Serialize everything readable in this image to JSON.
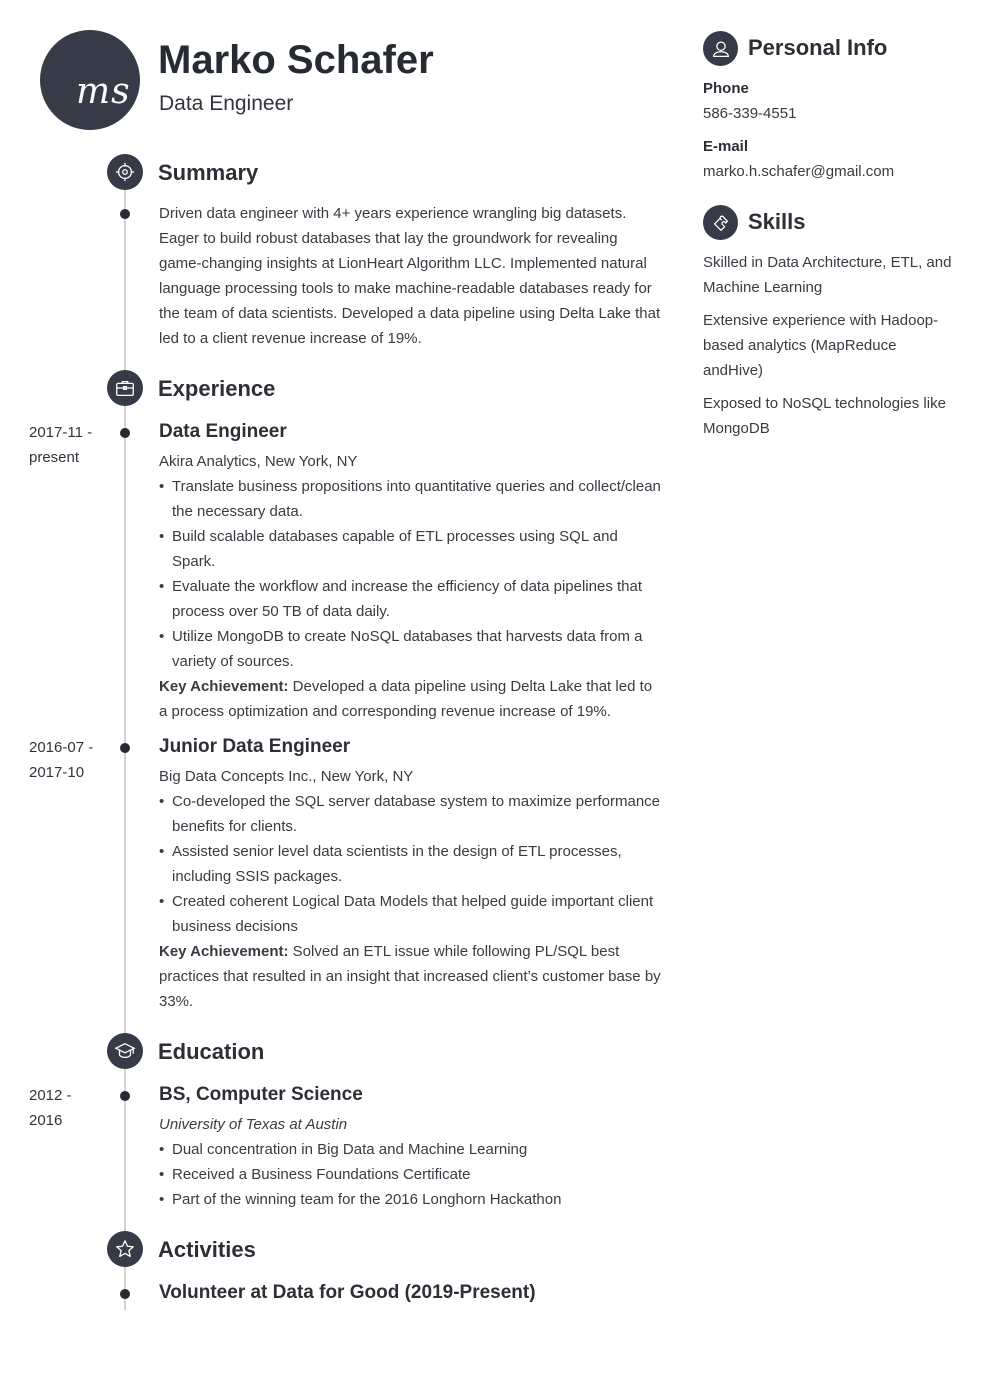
{
  "header": {
    "initials": "ms",
    "name": "Marko Schafer",
    "title": "Data Engineer"
  },
  "colors": {
    "accent": "#363b47",
    "text": "#2c2f36",
    "timeline": "#d3d3d3"
  },
  "summary": {
    "title": "Summary",
    "icon": "target-icon",
    "text": "Driven data engineer with 4+ years experience wrangling big datasets. Eager to build robust databases that lay the groundwork for revealing game-changing insights at LionHeart Algorithm LLC. Implemented natural language processing tools to make machine-readable databases ready for the team of data scientists. Developed a data pipeline using Delta Lake that led to a client revenue increase of 19%."
  },
  "experience": {
    "title": "Experience",
    "icon": "briefcase-icon",
    "jobs": [
      {
        "date_start": "2017-11 -",
        "date_end": "present",
        "title": "Data Engineer",
        "company": "Akira Analytics, New York, NY",
        "bullets": [
          "Translate business propositions into quantitative queries and collect/clean the necessary data.",
          "Build scalable databases capable of ETL processes using SQL and Spark.",
          "Evaluate the workflow and increase the efficiency of data pipelines that process over 50 TB of data daily.",
          "Utilize MongoDB to create NoSQL databases that harvests data from a variety of sources."
        ],
        "key_label": "Key Achievement:",
        "key_text": " Developed a data pipeline using Delta Lake that led to a process optimization and corresponding revenue increase of 19%."
      },
      {
        "date_start": "2016-07 -",
        "date_end": "2017-10",
        "title": "Junior Data Engineer",
        "company": "Big Data Concepts Inc., New York, NY",
        "bullets": [
          "Co-developed the SQL server database system to maximize performance benefits for clients.",
          "Assisted senior level data scientists in the design of ETL processes, including SSIS packages.",
          "Created coherent Logical Data Models that helped guide important client business decisions"
        ],
        "key_label": "Key Achievement:",
        "key_text": " Solved an ETL issue while following PL/SQL best practices that resulted in an insight that increased client’s customer base by 33%."
      }
    ]
  },
  "education": {
    "title": "Education",
    "icon": "graduation-cap-icon",
    "items": [
      {
        "date_start": "2012 -",
        "date_end": "2016",
        "degree": "BS, Computer Science",
        "school": "University of Texas at Austin",
        "bullets": [
          "Dual concentration in Big Data and Machine Learning",
          "Received a Business Foundations Certificate",
          "Part of the winning team for the 2016 Longhorn Hackathon"
        ]
      }
    ]
  },
  "activities": {
    "title": "Activities",
    "icon": "star-icon",
    "items": [
      {
        "title": "Volunteer at Data for Good (2019-Present)"
      }
    ]
  },
  "personal_info": {
    "title": "Personal Info",
    "icon": "user-icon",
    "phone_label": "Phone",
    "phone": "586-339-4551",
    "email_label": "E-mail",
    "email": "marko.h.schafer@gmail.com"
  },
  "skills": {
    "title": "Skills",
    "icon": "puzzle-icon",
    "items": [
      "Skilled in Data Architecture, ETL, and Machine Learning",
      "Extensive experience with Hadoop-based analytics (MapReduce andHive)",
      "Exposed to NoSQL technologies like MongoDB"
    ]
  }
}
